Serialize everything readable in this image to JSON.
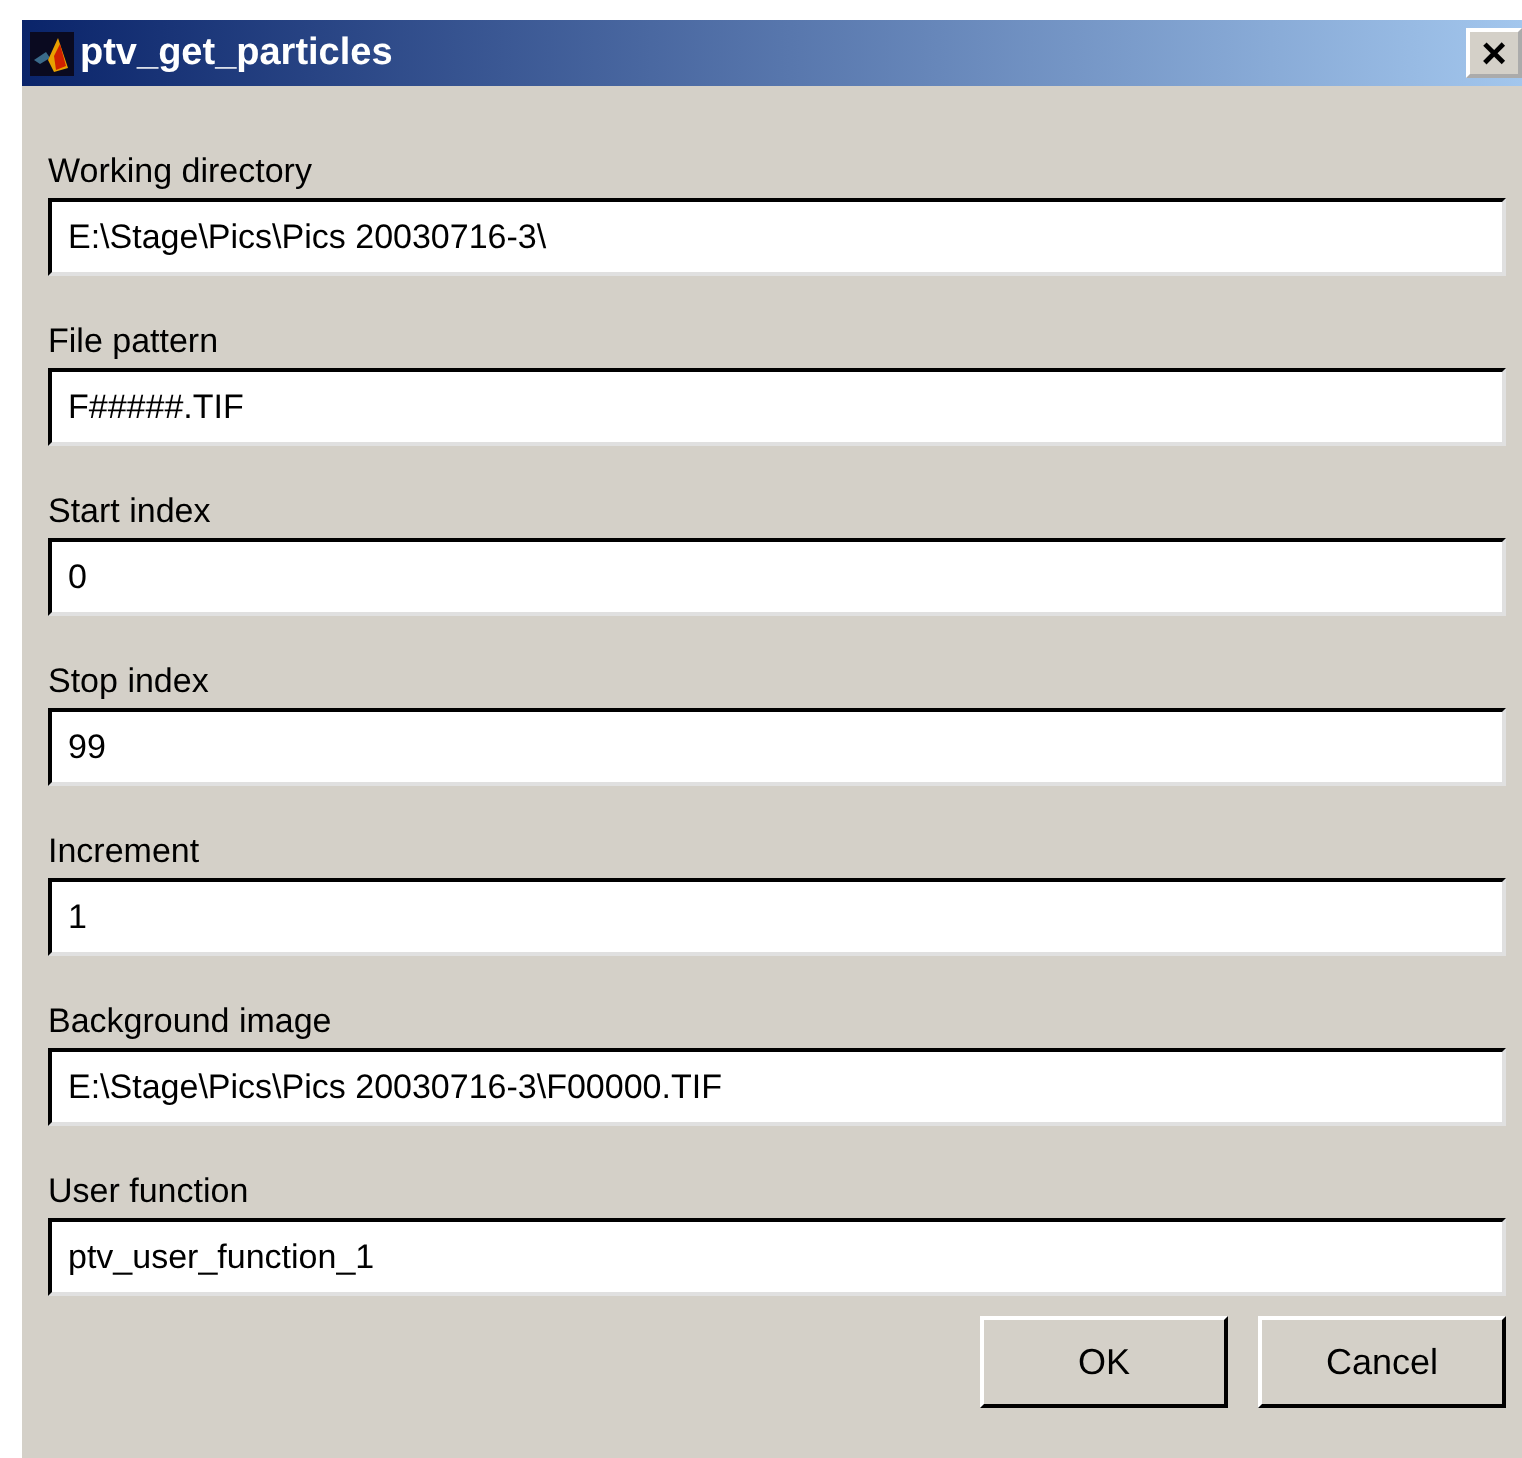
{
  "window": {
    "title": "ptv_get_particles",
    "close": "×"
  },
  "fields": [
    {
      "label": "Working directory",
      "value": "E:\\Stage\\Pics\\Pics 20030716-3\\"
    },
    {
      "label": "File pattern",
      "value": "F#####.TIF"
    },
    {
      "label": "Start index",
      "value": "0"
    },
    {
      "label": "Stop index",
      "value": "99"
    },
    {
      "label": "Increment",
      "value": "1"
    },
    {
      "label": "Background image",
      "value": "E:\\Stage\\Pics\\Pics 20030716-3\\F00000.TIF"
    },
    {
      "label": "User function",
      "value": "ptv_user_function_1"
    }
  ],
  "buttons": [
    "OK",
    "Cancel"
  ]
}
